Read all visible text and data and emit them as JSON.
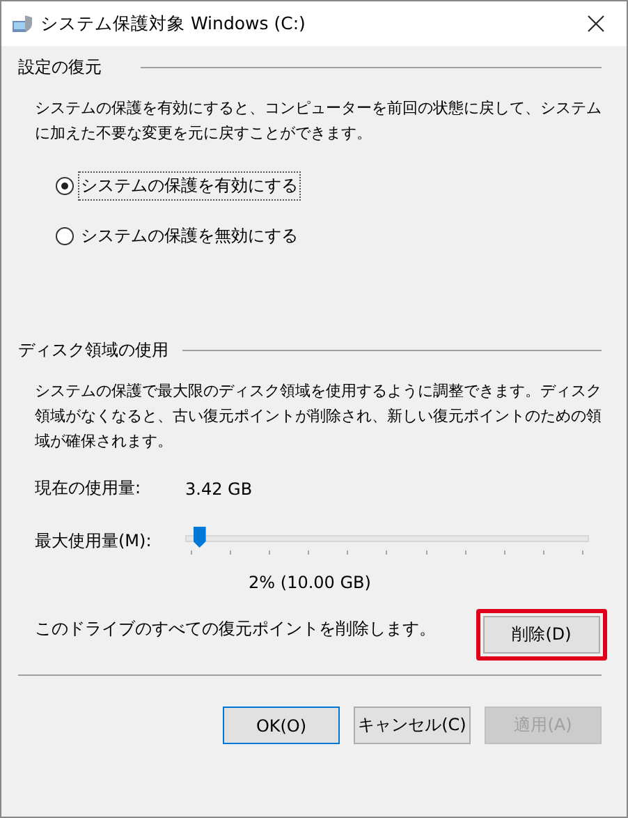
{
  "window": {
    "title": "システム保護対象 Windows (C:)"
  },
  "restore_settings": {
    "heading": "設定の復元",
    "description": "システムの保護を有効にすると、コンピューターを前回の状態に戻して、システムに加えた不要な変更を元に戻すことができます。",
    "options": [
      {
        "label": "システムの保護を有効にする",
        "selected": true
      },
      {
        "label": "システムの保護を無効にする",
        "selected": false
      }
    ]
  },
  "disk_usage": {
    "heading": "ディスク領域の使用",
    "description": "システムの保護で最大限のディスク領域を使用するように調整できます。ディスク領域がなくなると、古い復元ポイントが削除され、新しい復元ポイントのための領域が確保されます。",
    "current_label": "現在の使用量:",
    "current_value": "3.42 GB",
    "max_label": "最大使用量(M):",
    "max_slider": {
      "level": 0.02
    },
    "max_reading": "2% (10.00 GB)",
    "delete_text": "このドライブのすべての復元ポイントを削除します。",
    "delete_button": {
      "label": "削除(D)",
      "highlighted": true
    }
  },
  "buttons": [
    {
      "label": "OK(O)",
      "kind": "default",
      "disabled": false
    },
    {
      "label": "キャンセル(C)",
      "kind": "normal",
      "disabled": false
    },
    {
      "label": "適用(A)",
      "kind": "normal",
      "disabled": true
    }
  ]
}
